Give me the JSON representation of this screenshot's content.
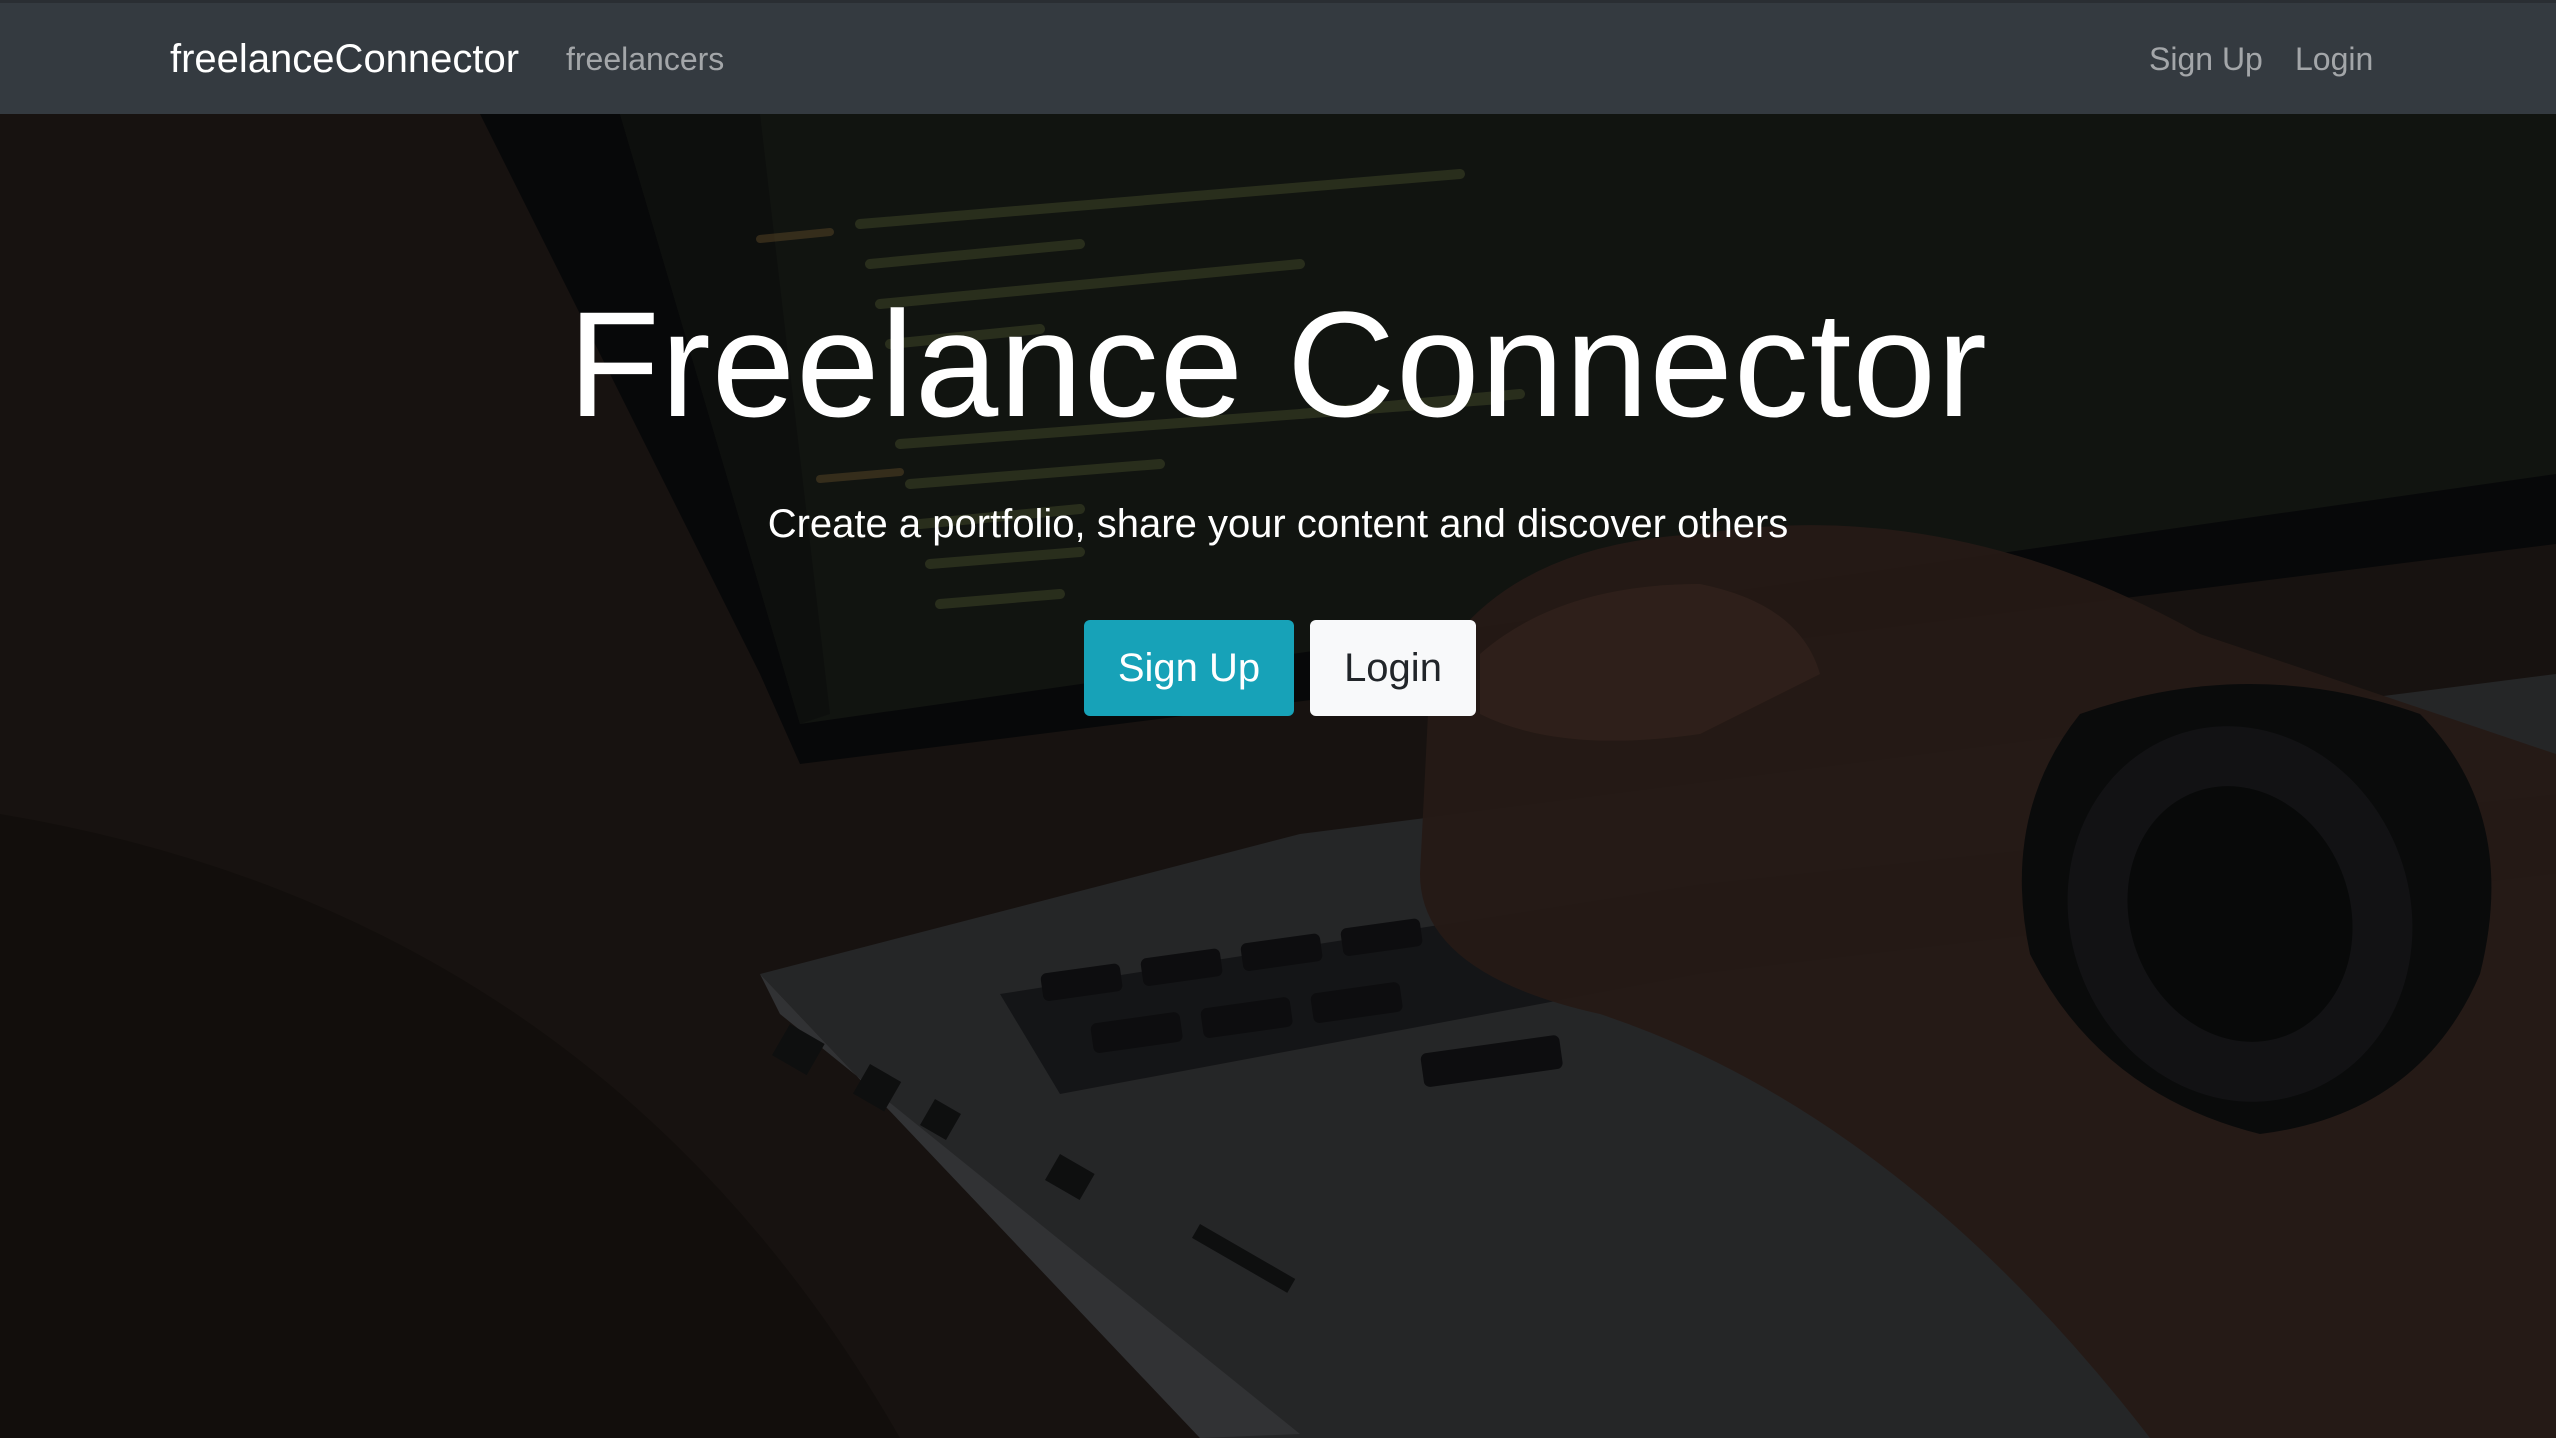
{
  "navbar": {
    "brand": "freelanceConnector",
    "links": {
      "freelancers": "freelancers",
      "sign_up": "Sign Up",
      "login": "Login"
    }
  },
  "hero": {
    "title": "Freelance Connector",
    "subtitle": "Create a portfolio, share your content and discover others",
    "buttons": {
      "sign_up": "Sign Up",
      "login": "Login"
    }
  },
  "colors": {
    "navbar": "#343a40",
    "primary_button": "#17a2b8",
    "light_button": "#f8f9fa"
  }
}
